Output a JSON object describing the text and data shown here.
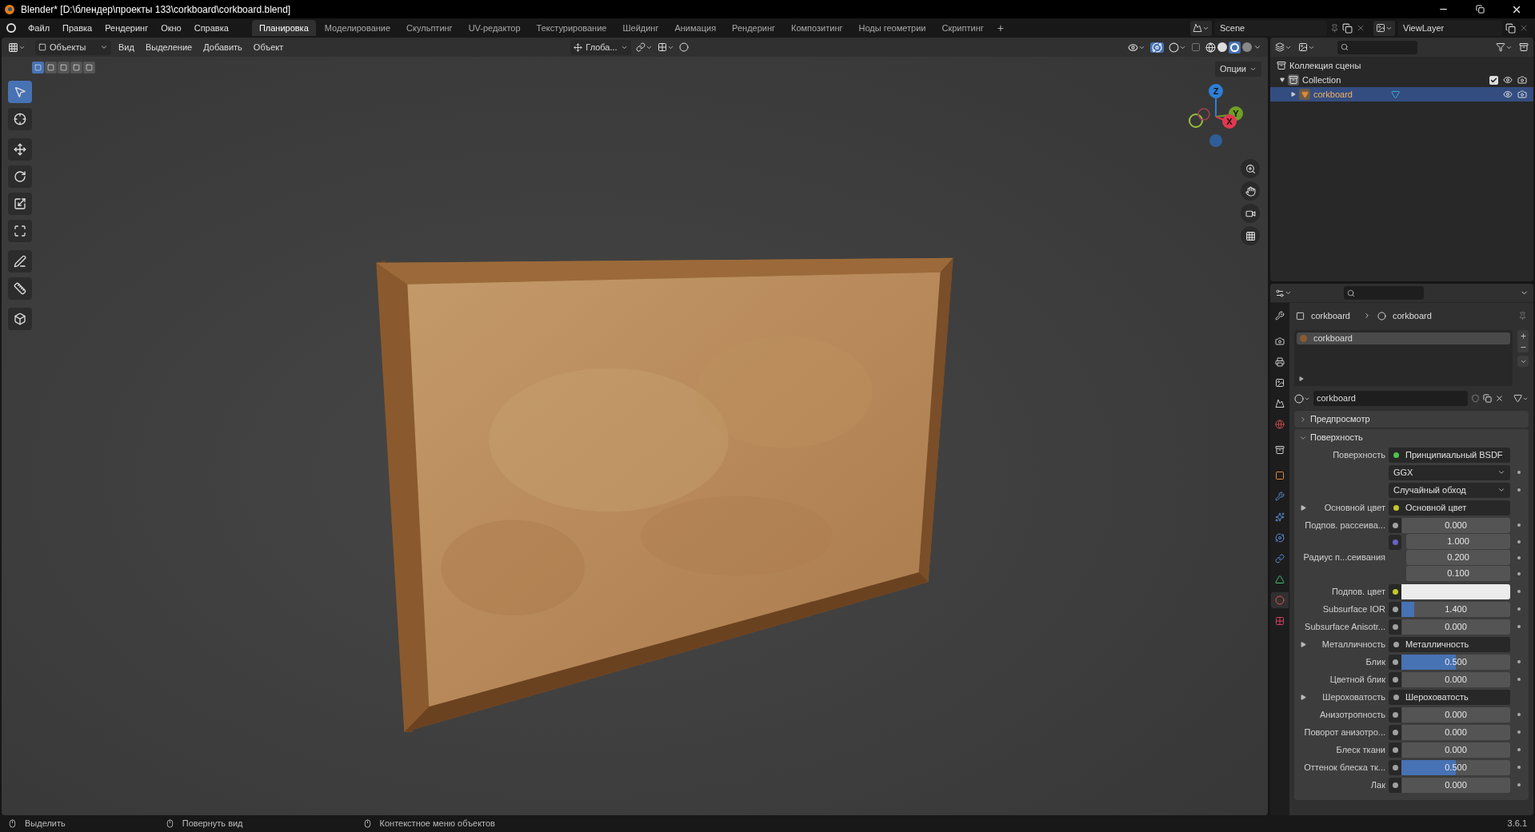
{
  "window": {
    "title": "Blender* [D:\\блендер\\проекты 133\\corkboard\\corkboard.blend]"
  },
  "menu": [
    "Файл",
    "Правка",
    "Рендеринг",
    "Окно",
    "Справка"
  ],
  "workspaces": [
    {
      "label": "Планировка",
      "selected": true
    },
    {
      "label": "Моделирование",
      "selected": false
    },
    {
      "label": "Скульптинг",
      "selected": false
    },
    {
      "label": "UV-редактор",
      "selected": false
    },
    {
      "label": "Текстурирование",
      "selected": false
    },
    {
      "label": "Шейдинг",
      "selected": false
    },
    {
      "label": "Анимация",
      "selected": false
    },
    {
      "label": "Рендеринг",
      "selected": false
    },
    {
      "label": "Композитинг",
      "selected": false
    },
    {
      "label": "Ноды геометрии",
      "selected": false
    },
    {
      "label": "Скриптинг",
      "selected": false
    }
  ],
  "add_workspace": "+",
  "scene": {
    "value": "Scene"
  },
  "view_layer": {
    "value": "ViewLayer"
  },
  "viewport": {
    "mode": "Объекты",
    "menus": [
      "Вид",
      "Выделение",
      "Добавить",
      "Объект"
    ],
    "orientation": "Глоба...",
    "options": "Опции",
    "select_modes": [
      {
        "selected": true
      },
      {
        "selected": false
      },
      {
        "selected": false
      },
      {
        "selected": false
      },
      {
        "selected": false
      }
    ],
    "tools": [
      {
        "kind": "select",
        "selected": true
      },
      {
        "kind": "cursor",
        "selected": false
      },
      {
        "kind": "move",
        "selected": false
      },
      {
        "kind": "rotate",
        "selected": false
      },
      {
        "kind": "scale",
        "selected": false
      },
      {
        "kind": "transform",
        "selected": false
      },
      {
        "kind": "annotate",
        "selected": false
      },
      {
        "kind": "measure",
        "selected": false
      },
      {
        "kind": "add-cube",
        "selected": false
      }
    ],
    "gizmo": {
      "axes": [
        {
          "label": "Z",
          "color": "#2f7fd8"
        },
        {
          "label": "Y",
          "color": "#6ea025"
        },
        {
          "label": "X",
          "color": "#e0384f"
        }
      ]
    }
  },
  "outliner": {
    "tree": [
      {
        "label": "Коллекция сцены",
        "kind": "scene",
        "children": [
          {
            "label": "Collection",
            "kind": "collection",
            "expanded": true,
            "checked": true,
            "children": [
              {
                "label": "corkboard",
                "kind": "object",
                "selected": true,
                "expanded": false
              }
            ]
          }
        ]
      }
    ]
  },
  "properties": {
    "tabs": [
      {
        "kind": "tool",
        "selected": false
      },
      {
        "kind": "render",
        "selected": false
      },
      {
        "kind": "output",
        "selected": false
      },
      {
        "kind": "view-layer",
        "selected": false
      },
      {
        "kind": "scene",
        "selected": false
      },
      {
        "kind": "world",
        "selected": false
      },
      {
        "kind": "collection",
        "selected": false
      },
      {
        "kind": "object",
        "selected": false
      },
      {
        "kind": "modifiers",
        "selected": false
      },
      {
        "kind": "particles",
        "selected": false
      },
      {
        "kind": "physics",
        "selected": false
      },
      {
        "kind": "constraints",
        "selected": false
      },
      {
        "kind": "data",
        "selected": false
      },
      {
        "kind": "material",
        "selected": true
      },
      {
        "kind": "texture",
        "selected": false
      }
    ],
    "breadcrumb": [
      "corkboard",
      "corkboard"
    ],
    "slots": [
      {
        "label": "corkboard",
        "selected": true
      }
    ],
    "material": {
      "value": "corkboard"
    },
    "panels": [
      {
        "title": "Предпросмотр",
        "expanded": false
      },
      {
        "title": "Поверхность",
        "expanded": true
      }
    ],
    "rows": [
      {
        "kind": "link",
        "label": "Поверхность",
        "value": "Принципиальный BSDF",
        "socket": {
          "color": "#4ec24e"
        }
      },
      {
        "kind": "enum",
        "value": "GGX"
      },
      {
        "kind": "enum",
        "value": "Случайный обход"
      },
      {
        "kind": "link",
        "label": "Основной цвет",
        "value": "Основной цвет",
        "socket": {
          "color": "#c7c729"
        },
        "expanded": false
      },
      {
        "kind": "value",
        "label": "Подпов. рассеива...",
        "value": "0.000",
        "level": 0,
        "socket": {
          "color": "#a1a1a1"
        }
      },
      {
        "kind": "vector",
        "label": "Радиус п...сеивания",
        "values": [
          "1.000",
          "0.200",
          "0.100"
        ],
        "socket": {
          "color": "#6363c7"
        }
      },
      {
        "kind": "color",
        "label": "Подпов. цвет",
        "color": "#ececec",
        "socket": {
          "color": "#c7c729"
        }
      },
      {
        "kind": "value",
        "label": "Subsurface IOR",
        "value": "1.400",
        "level": 0.12,
        "socket": {
          "color": "#a1a1a1"
        }
      },
      {
        "kind": "value",
        "label": "Subsurface Anisotr...",
        "value": "0.000",
        "level": 0,
        "socket": {
          "color": "#a1a1a1"
        }
      },
      {
        "kind": "link",
        "label": "Металличность",
        "value": "Металличность",
        "socket": {
          "color": "#a1a1a1"
        },
        "expanded": false
      },
      {
        "kind": "value",
        "label": "Блик",
        "value": "0.500",
        "level": 0.5,
        "socket": {
          "color": "#a1a1a1"
        }
      },
      {
        "kind": "value",
        "label": "Цветной блик",
        "value": "0.000",
        "level": 0,
        "socket": {
          "color": "#a1a1a1"
        }
      },
      {
        "kind": "link",
        "label": "Шероховатость",
        "value": "Шероховатость",
        "socket": {
          "color": "#a1a1a1"
        },
        "expanded": false
      },
      {
        "kind": "value",
        "label": "Анизотропность",
        "value": "0.000",
        "level": 0,
        "socket": {
          "color": "#a1a1a1"
        }
      },
      {
        "kind": "value",
        "label": "Поворот анизотро...",
        "value": "0.000",
        "level": 0,
        "socket": {
          "color": "#a1a1a1"
        }
      },
      {
        "kind": "value",
        "label": "Блеск ткани",
        "value": "0.000",
        "level": 0,
        "socket": {
          "color": "#a1a1a1"
        }
      },
      {
        "kind": "value",
        "label": "Оттенок блеска тк...",
        "value": "0.500",
        "level": 0.5,
        "socket": {
          "color": "#a1a1a1"
        }
      },
      {
        "kind": "value",
        "label": "Лак",
        "value": "0.000",
        "level": 0,
        "socket": {
          "color": "#a1a1a1"
        }
      }
    ]
  },
  "status_bar": {
    "hints": [
      "Выделить",
      "Повернуть вид",
      "Контекстное меню объектов"
    ],
    "version": "3.6.1"
  }
}
